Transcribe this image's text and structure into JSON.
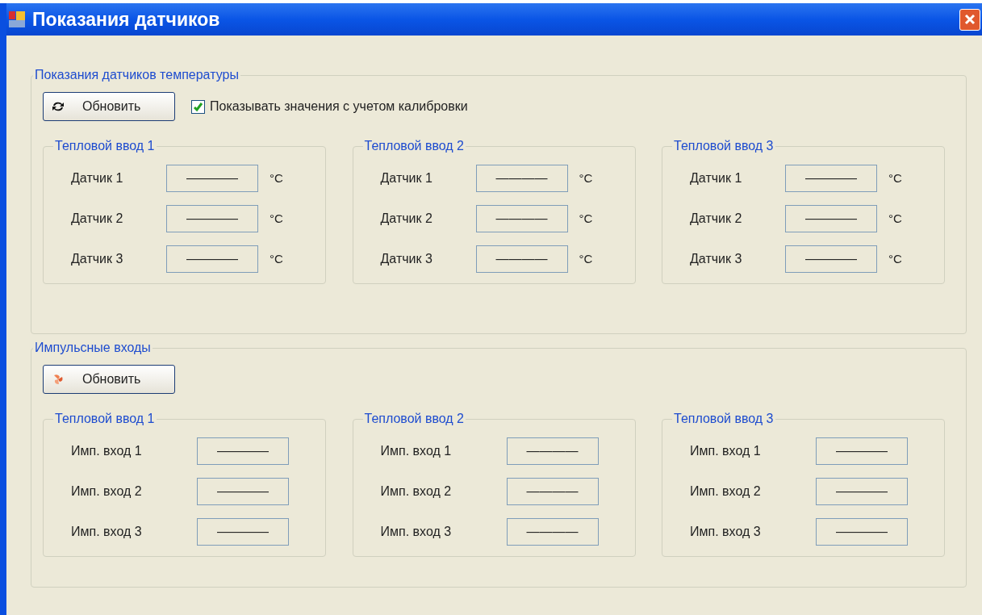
{
  "window": {
    "title": "Показания датчиков"
  },
  "groups": [
    {
      "kind": "temperature",
      "title": "Показания датчиков температуры",
      "refresh_button": {
        "label": "Обновить"
      },
      "checkbox": {
        "label": "Показывать значения с учетом калибровки",
        "checked": true
      },
      "panels": [
        {
          "title": "Тепловой ввод 1",
          "rows": [
            {
              "label": "Датчик 1",
              "value": "————",
              "unit": "°C"
            },
            {
              "label": "Датчик 2",
              "value": "————",
              "unit": "°C"
            },
            {
              "label": "Датчик 3",
              "value": "————",
              "unit": "°C"
            }
          ]
        },
        {
          "title": "Тепловой ввод 2",
          "rows": [
            {
              "label": "Датчик 1",
              "value": "————",
              "unit": "°C"
            },
            {
              "label": "Датчик 2",
              "value": "————",
              "unit": "°C"
            },
            {
              "label": "Датчик 3",
              "value": "————",
              "unit": "°C"
            }
          ]
        },
        {
          "title": "Тепловой ввод 3",
          "rows": [
            {
              "label": "Датчик 1",
              "value": "————",
              "unit": "°C"
            },
            {
              "label": "Датчик 2",
              "value": "————",
              "unit": "°C"
            },
            {
              "label": "Датчик 3",
              "value": "————",
              "unit": "°C"
            }
          ]
        }
      ]
    },
    {
      "kind": "pulse",
      "title": "Импульсные входы",
      "refresh_button": {
        "label": "Обновить"
      },
      "panels": [
        {
          "title": "Тепловой ввод 1",
          "rows": [
            {
              "label": "Имп. вход 1",
              "value": "————"
            },
            {
              "label": "Имп. вход 2",
              "value": "————"
            },
            {
              "label": "Имп. вход 3",
              "value": "————"
            }
          ]
        },
        {
          "title": "Тепловой ввод 2",
          "rows": [
            {
              "label": "Имп. вход 1",
              "value": "————"
            },
            {
              "label": "Имп. вход 2",
              "value": "————"
            },
            {
              "label": "Имп. вход 3",
              "value": "————"
            }
          ]
        },
        {
          "title": "Тепловой ввод 3",
          "rows": [
            {
              "label": "Имп. вход 1",
              "value": "————"
            },
            {
              "label": "Имп. вход 2",
              "value": "————"
            },
            {
              "label": "Имп. вход 3",
              "value": "————"
            }
          ]
        }
      ]
    }
  ]
}
